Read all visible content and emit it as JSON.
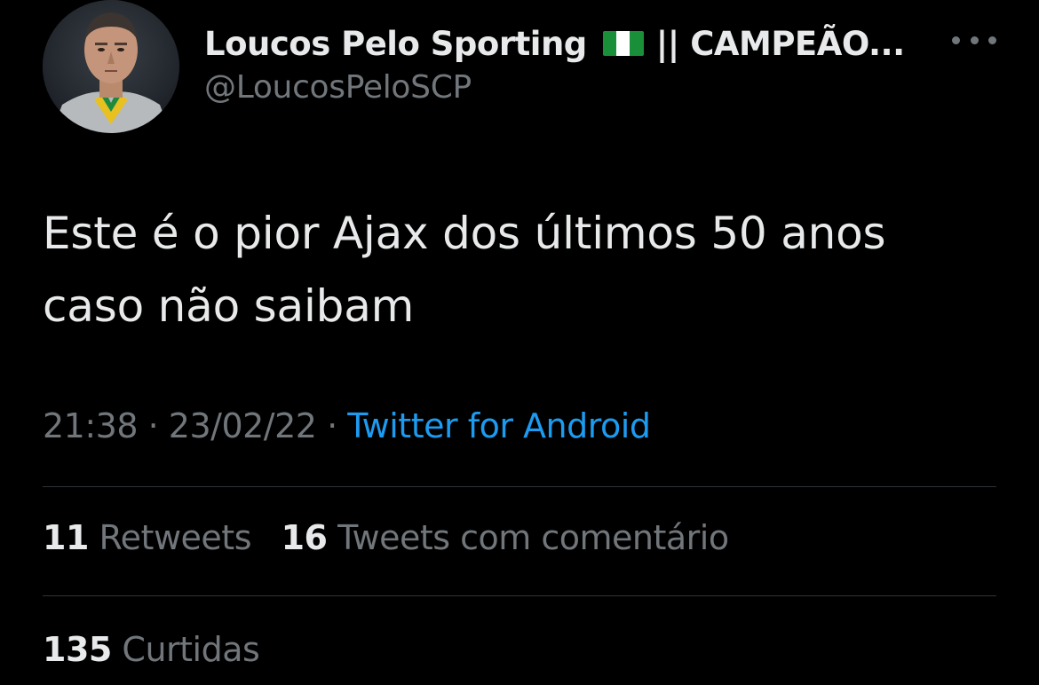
{
  "tweet": {
    "author": {
      "display_name": "Loucos Pelo Sporting",
      "flag_icon": "nigeria-flag-icon",
      "name_suffix": "|| CAMPEÃO...",
      "handle": "@LoucosPeloSCP"
    },
    "text_line1": "Este é o pior Ajax dos últimos 50 anos",
    "text_line2": "caso não saibam",
    "time": "21:38",
    "sep1": "·",
    "date": "23/02/22",
    "sep2": "·",
    "source": "Twitter for Android",
    "stats": {
      "retweets_count": "11",
      "retweets_label": "Retweets",
      "quotes_count": "16",
      "quotes_label": "Tweets com comentário",
      "likes_count": "135",
      "likes_label": "Curtidas"
    }
  },
  "colors": {
    "background": "#000000",
    "text_primary": "#e7e9ea",
    "text_secondary": "#71767b",
    "link": "#1d9bf0",
    "divider": "#2f3336"
  }
}
